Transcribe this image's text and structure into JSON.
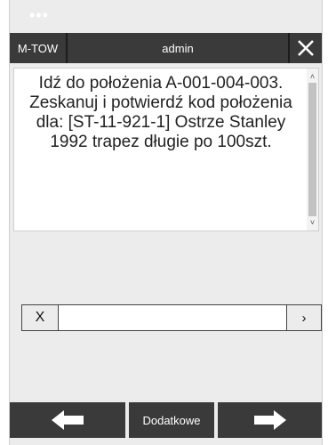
{
  "header": {
    "left_label": "M-TOW",
    "user": "admin",
    "close_label": "✕"
  },
  "message": {
    "text": "Idź do położenia A-001-004-003.\nZeskanuj i potwierdź kod położenia\ndla: [ST-11-921-1] Ostrze Stanley 1992 trapez długie po 100szt."
  },
  "input": {
    "clear_label": "X",
    "value": "",
    "submit_label": "›"
  },
  "footer": {
    "back_icon": "arrow-left-icon",
    "extra_label": "Dodatkowe",
    "next_icon": "arrow-right-icon"
  }
}
